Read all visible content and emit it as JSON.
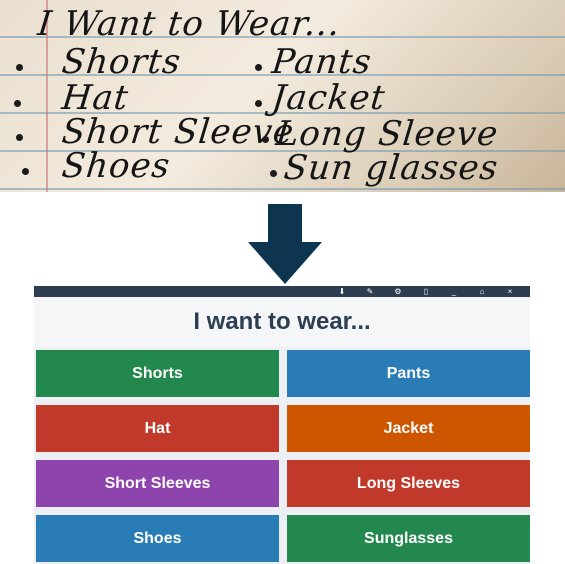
{
  "photo": {
    "heading": "I Want to Wear...",
    "left_items": [
      "Shorts",
      "Hat",
      "Short Sleeve",
      "Shoes"
    ],
    "right_items": [
      "Pants",
      "Jacket",
      "Long Sleeve",
      "Sun glasses"
    ]
  },
  "toolbar": {
    "icons": [
      "download-icon",
      "pencil-icon",
      "gear-icon",
      "chart-icon",
      "minimize-icon",
      "home-icon",
      "close-icon"
    ],
    "glyphs": [
      "⬇",
      "✎",
      "⚙",
      "▯",
      "_",
      "⌂",
      "×"
    ]
  },
  "board": {
    "title": "I want to wear...",
    "tiles": [
      {
        "label": "Shorts",
        "color": "#23884d"
      },
      {
        "label": "Pants",
        "color": "#2a7cb6"
      },
      {
        "label": "Hat",
        "color": "#c0392b"
      },
      {
        "label": "Jacket",
        "color": "#cf5600"
      },
      {
        "label": "Short Sleeves",
        "color": "#8e44ad"
      },
      {
        "label": "Long Sleeves",
        "color": "#c0392b"
      },
      {
        "label": "Shoes",
        "color": "#2a7cb6"
      },
      {
        "label": "Sunglasses",
        "color": "#23884d"
      }
    ]
  },
  "arrow_color": "#0e3550"
}
